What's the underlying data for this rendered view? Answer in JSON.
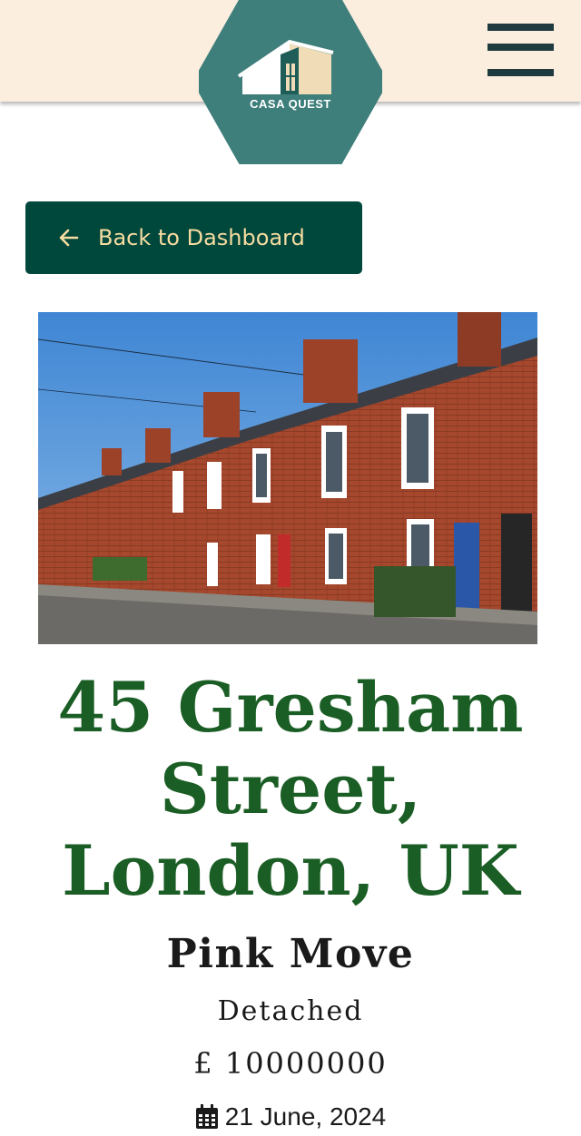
{
  "header": {
    "logo_text": "CASA QUEST",
    "logo_icon": "house-logo-icon",
    "menu_icon": "hamburger-menu-icon"
  },
  "back_button": {
    "label": "Back to Dashboard",
    "icon": "arrow-left-icon"
  },
  "property": {
    "address": "45 Gresham Street, London, UK",
    "agent": "Pink Move",
    "type": "Detached",
    "price": "£ 10000000",
    "date": "21 June, 2024",
    "date_icon": "calendar-icon"
  },
  "colors": {
    "header_bg": "#fbeede",
    "logo_teal": "#3d7f7c",
    "button_bg": "#00473c",
    "button_text": "#f6dca0",
    "address_green": "#1b5e25"
  }
}
